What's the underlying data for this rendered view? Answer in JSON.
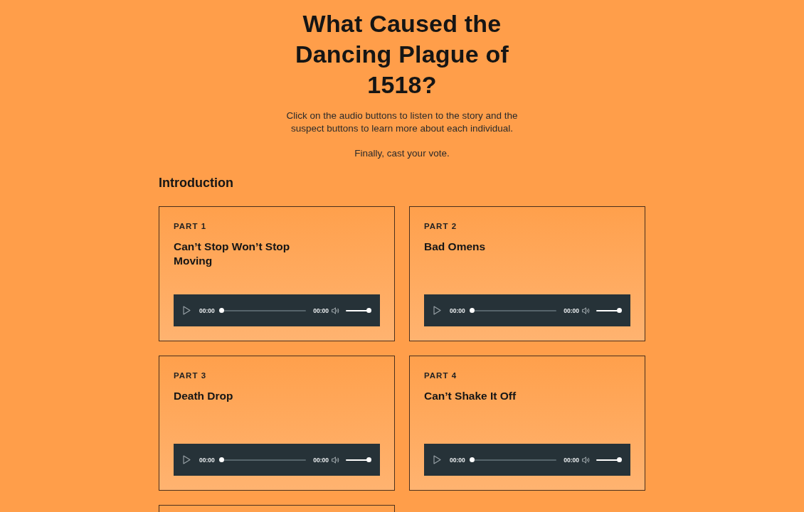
{
  "page": {
    "title": "What Caused the Dancing Plague of 1518?",
    "intro": "Click on the audio buttons to listen to the story and the suspect buttons to learn more about each individual.",
    "prompt": "Finally, cast your vote."
  },
  "section": {
    "heading": "Introduction",
    "parts": [
      {
        "kind": "audio",
        "label": "PART 1",
        "title": "Can’t Stop Won’t Stop Moving",
        "player": {
          "current_time": "00:00",
          "progress": {
            "level": 0
          },
          "duration": "00:00",
          "volume": {
            "level": 1
          }
        }
      },
      {
        "kind": "audio",
        "label": "PART 2",
        "title": "Bad Omens",
        "player": {
          "current_time": "00:00",
          "progress": {
            "level": 0
          },
          "duration": "00:00",
          "volume": {
            "level": 1
          }
        }
      },
      {
        "kind": "audio",
        "label": "PART 3",
        "title": "Death Drop",
        "player": {
          "current_time": "00:00",
          "progress": {
            "level": 0
          },
          "duration": "00:00",
          "volume": {
            "level": 1
          }
        }
      },
      {
        "kind": "audio",
        "label": "PART 4",
        "title": "Can’t Shake It Off",
        "player": {
          "current_time": "00:00",
          "progress": {
            "level": 0
          },
          "duration": "00:00",
          "volume": {
            "level": 1
          }
        }
      },
      {
        "kind": "cut_off"
      }
    ]
  }
}
